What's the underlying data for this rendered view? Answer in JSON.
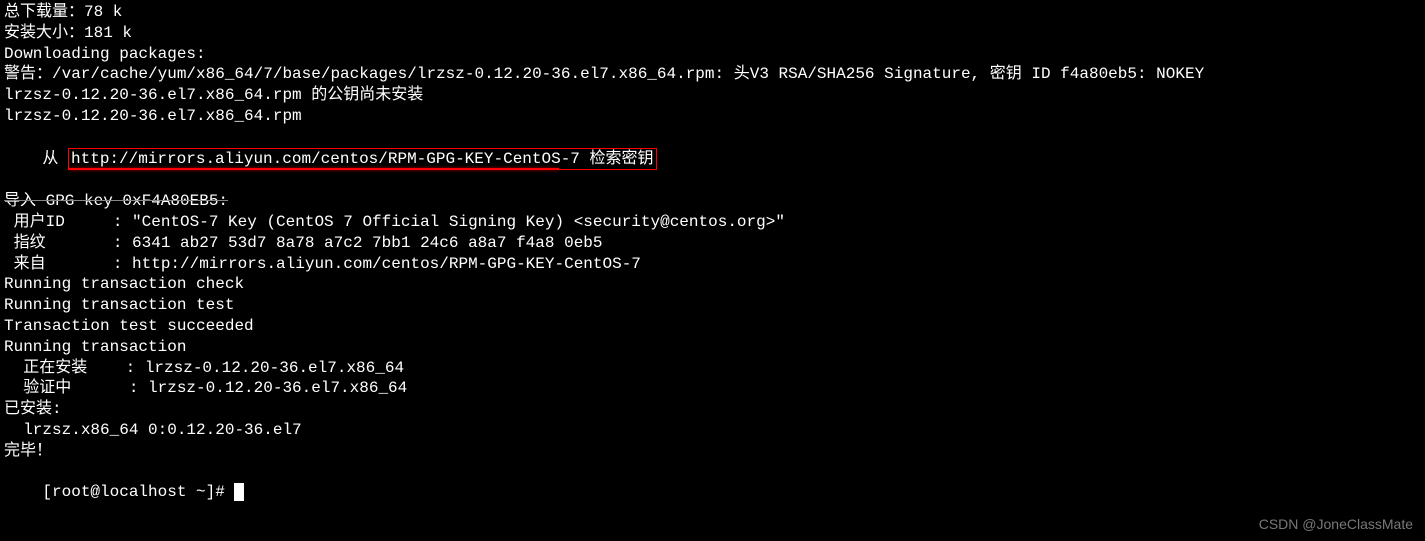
{
  "lines": {
    "l1": "总下载量：78 k",
    "l2": "安装大小：181 k",
    "l3": "Downloading packages:",
    "l4": "警告：/var/cache/yum/x86_64/7/base/packages/lrzsz-0.12.20-36.el7.x86_64.rpm: 头V3 RSA/SHA256 Signature, 密钥 ID f4a80eb5: NOKEY",
    "l5": "lrzsz-0.12.20-36.el7.x86_64.rpm 的公钥尚未安装",
    "l6": "lrzsz-0.12.20-36.el7.x86_64.rpm",
    "l7_prefix": "从 ",
    "l7_boxed": "http://mirrors.aliyun.com/centos/RPM-GPG-KEY-CentOS-7 检索密钥",
    "l8": "导入 GPG key 0xF4A80EB5:",
    "l9": " 用户ID     : \"CentOS-7 Key (CentOS 7 Official Signing Key) <security@centos.org>\"",
    "l10": " 指纹       : 6341 ab27 53d7 8a78 a7c2 7bb1 24c6 a8a7 f4a8 0eb5",
    "l11": " 来自       : http://mirrors.aliyun.com/centos/RPM-GPG-KEY-CentOS-7",
    "l12": "Running transaction check",
    "l13": "Running transaction test",
    "l14": "Transaction test succeeded",
    "l15": "Running transaction",
    "l16": "  正在安装    : lrzsz-0.12.20-36.el7.x86_64",
    "l17": "  验证中      : lrzsz-0.12.20-36.el7.x86_64",
    "l18": "",
    "l19": "已安装:",
    "l20": "  lrzsz.x86_64 0:0.12.20-36.el7",
    "l21": "",
    "l22": "完毕！",
    "prompt": "[root@localhost ~]# "
  },
  "watermark": "CSDN @JoneClassMate"
}
